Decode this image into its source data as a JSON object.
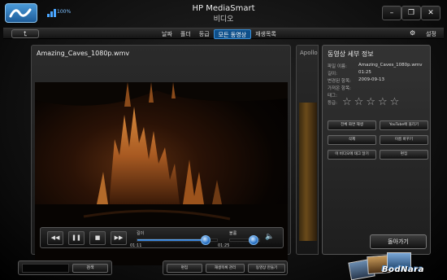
{
  "app": {
    "title": "HP MediaSmart",
    "subtitle": "비디오",
    "battery": "100%",
    "window_buttons": [
      "–",
      "❐",
      "✕"
    ]
  },
  "nav": {
    "back_label": "⮤",
    "tabs": [
      {
        "label": "날짜",
        "active": false
      },
      {
        "label": "폴더",
        "active": false
      },
      {
        "label": "등급",
        "active": false
      },
      {
        "label": "모든 동영상",
        "active": true
      },
      {
        "label": "재생목록",
        "active": false
      }
    ],
    "settings_label": "설정"
  },
  "player": {
    "file_title": "Amazing_Caves_1080p.wmv",
    "controls": {
      "rewind": "◀◀",
      "pause": "❚❚",
      "stop": "■",
      "forward": "▶▶"
    },
    "seek_label": "길이",
    "current_time": "01:11",
    "total_time": "01:25",
    "progress": 0.835,
    "volume_label": "볼륨",
    "volume": 0.75
  },
  "peek": {
    "title": "Apollo"
  },
  "details": {
    "title": "동영상 세부 정보",
    "rows": [
      {
        "label": "파일 이름:",
        "value": "Amazing_Caves_1080p.wmv"
      },
      {
        "label": "길이:",
        "value": "01:25"
      },
      {
        "label": "변경된 항목:",
        "value": "2009-09-13"
      },
      {
        "label": "가져온 항목:",
        "value": ""
      },
      {
        "label": "태그:",
        "value": ""
      },
      {
        "label": "등급:",
        "value": ""
      }
    ],
    "rating": 0,
    "rating_max": 5,
    "actions": [
      "전체 화면 재생",
      "YouTube에 올리기",
      "삭제",
      "이름 바꾸기",
      "이 비디오에 태그 달기",
      "편집"
    ],
    "back_button": "돌아가기"
  },
  "bottom": {
    "search_placeholder": "",
    "search_button": "검색",
    "center_buttons": [
      "편집",
      "재생목록 관리",
      "동영상 만들기"
    ]
  },
  "watermark": "BodNara",
  "colors": {
    "accent": "#0e4f8a",
    "highlight": "#3b8ed5"
  }
}
